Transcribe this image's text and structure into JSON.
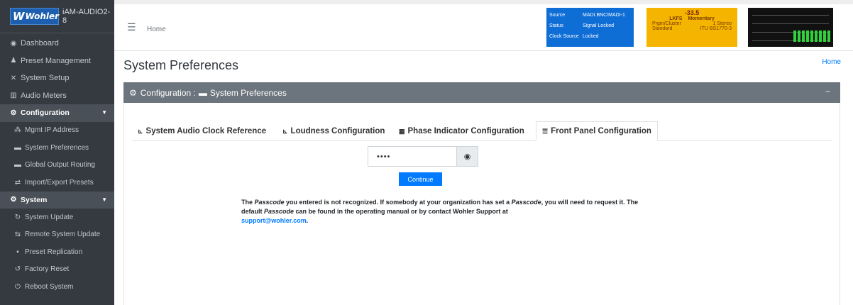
{
  "brand": {
    "logo_text": "Wohler",
    "device_name": "iAM-AUDIO2-8"
  },
  "sidebar": {
    "items": [
      {
        "label": "Dashboard",
        "icon": "dashboard-icon",
        "glyph": "◉"
      },
      {
        "label": "Preset Management",
        "icon": "user-cog-icon",
        "glyph": "👥"
      },
      {
        "label": "System Setup",
        "icon": "tools-icon",
        "glyph": "✕"
      },
      {
        "label": "Audio Meters",
        "icon": "bar-chart-icon",
        "glyph": "▥"
      },
      {
        "label": "Configuration",
        "icon": "gear-icon",
        "glyph": "⚙"
      },
      {
        "label": "Mgmt IP Address",
        "icon": "network-icon",
        "glyph": "⁂"
      },
      {
        "label": "System Preferences",
        "icon": "keyboard-icon",
        "glyph": "▬"
      },
      {
        "label": "Global Output Routing",
        "icon": "keyboard-icon",
        "glyph": "▬"
      },
      {
        "label": "Import/Export Presets",
        "icon": "exchange-icon",
        "glyph": "⇄"
      },
      {
        "label": "System",
        "icon": "gears-icon",
        "glyph": "⚙"
      },
      {
        "label": "System Update",
        "icon": "sync-icon",
        "glyph": "↻"
      },
      {
        "label": "Remote System Update",
        "icon": "satellite-icon",
        "glyph": "⇆"
      },
      {
        "label": "Preset Replication",
        "icon": "copy-icon",
        "glyph": "▪"
      },
      {
        "label": "Factory Reset",
        "icon": "undo-icon",
        "glyph": "↺"
      },
      {
        "label": "Reboot System",
        "icon": "power-icon",
        "glyph": "⏻"
      }
    ]
  },
  "topbar": {
    "home": "Home",
    "source": {
      "rows": [
        {
          "k": "Source",
          "v": "MADI.BNC/MADI-1"
        },
        {
          "k": "Status",
          "v": "Signal Locked"
        },
        {
          "k": "Clock Source",
          "v": "Locked"
        }
      ],
      "color": "#0f6ed6"
    },
    "loudness": {
      "value": "-33.5",
      "unit": "LKFS",
      "mode": "Momentary",
      "cluster_label": "Prgm/Cluster",
      "cluster_value": "1  Stereo",
      "standard_label": "Standard",
      "standard_value": "ITU BS1770-3",
      "color": "#f4b400"
    }
  },
  "page": {
    "title": "System Preferences",
    "breadcrumb": "Home",
    "card_title_prefix": "Configuration : ",
    "card_title": "System Preferences",
    "minimize": "−"
  },
  "tabs": [
    {
      "label": "System Audio Clock Reference",
      "icon": "chart-icon"
    },
    {
      "label": "Loudness Configuration",
      "icon": "chart-icon"
    },
    {
      "label": "Phase Indicator Configuration",
      "icon": "grid-icon"
    },
    {
      "label": "Front Panel Configuration",
      "icon": "list-icon",
      "active": true
    }
  ],
  "form": {
    "passcode_value": "••••",
    "continue_label": "Continue"
  },
  "message": {
    "part1": "The ",
    "passcode_word": "Passcode",
    "part2": " you entered is not recognized. If somebody at your organization has set a ",
    "part3": ", you will need to request it. The default ",
    "part4": " can be found in the operating manual or by contact Wohler Support at ",
    "email": "support@wohler.com",
    "end": "."
  }
}
